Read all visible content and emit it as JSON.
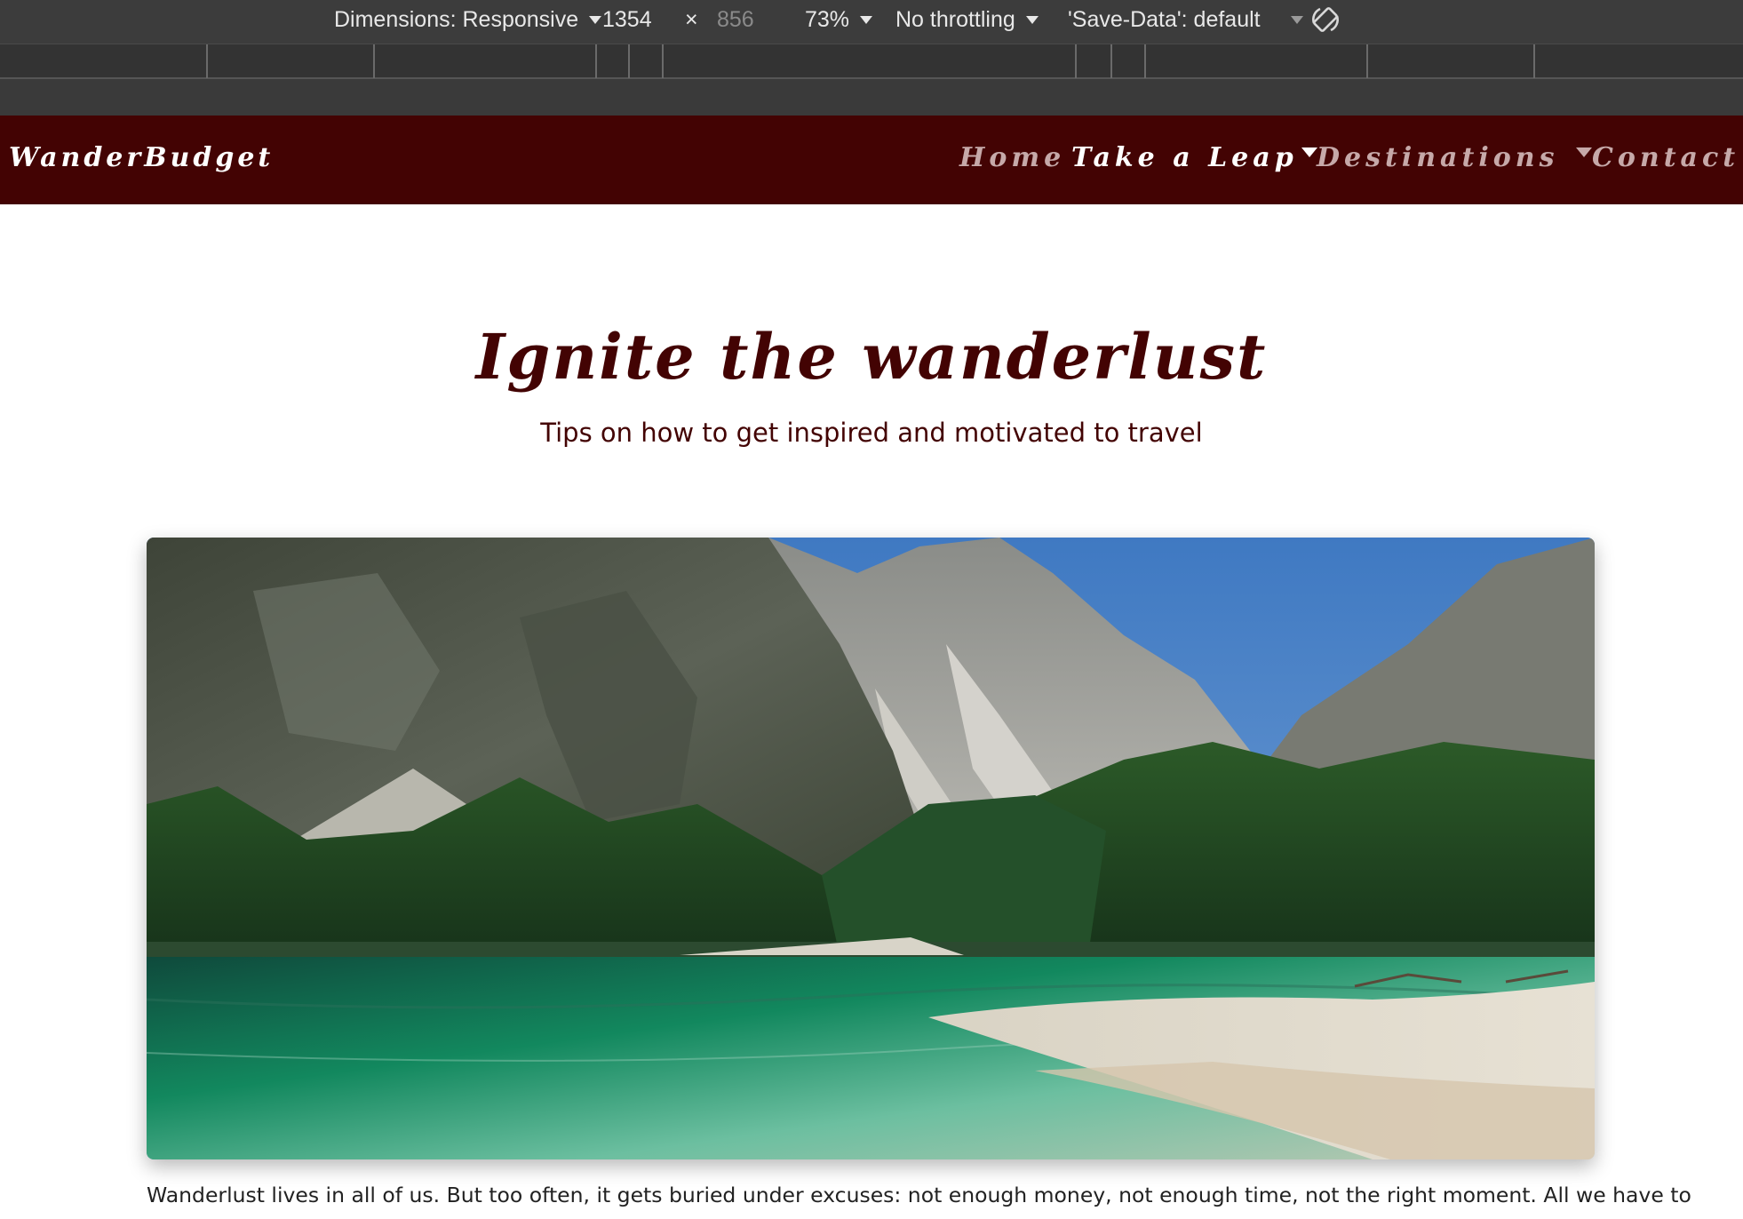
{
  "devtools": {
    "dimensions_label": "Dimensions: Responsive",
    "width_value": "1354",
    "times_symbol": "×",
    "height_placeholder": "856",
    "zoom": "73%",
    "throttling": "No throttling",
    "save_data": "'Save-Data': default"
  },
  "navbar": {
    "brand": "WanderBudget",
    "links": [
      {
        "label": "Home"
      },
      {
        "label": "Take a Leap"
      },
      {
        "label": "Destinations"
      },
      {
        "label": "Contact"
      }
    ]
  },
  "hero": {
    "title": "Ignite the wanderlust",
    "subtitle": "Tips on how to get inspired and motivated to travel"
  },
  "article": {
    "intro": "Wanderlust lives in all of us. But too often, it gets buried under excuses: not enough money, not enough time, not the right moment. All we have to"
  },
  "colors": {
    "navbar_bg": "#430303",
    "accent": "#430303",
    "devtools_bg": "#3c3c3c"
  },
  "icons": [
    "dropdown-caret-icon",
    "rotate-icon"
  ]
}
